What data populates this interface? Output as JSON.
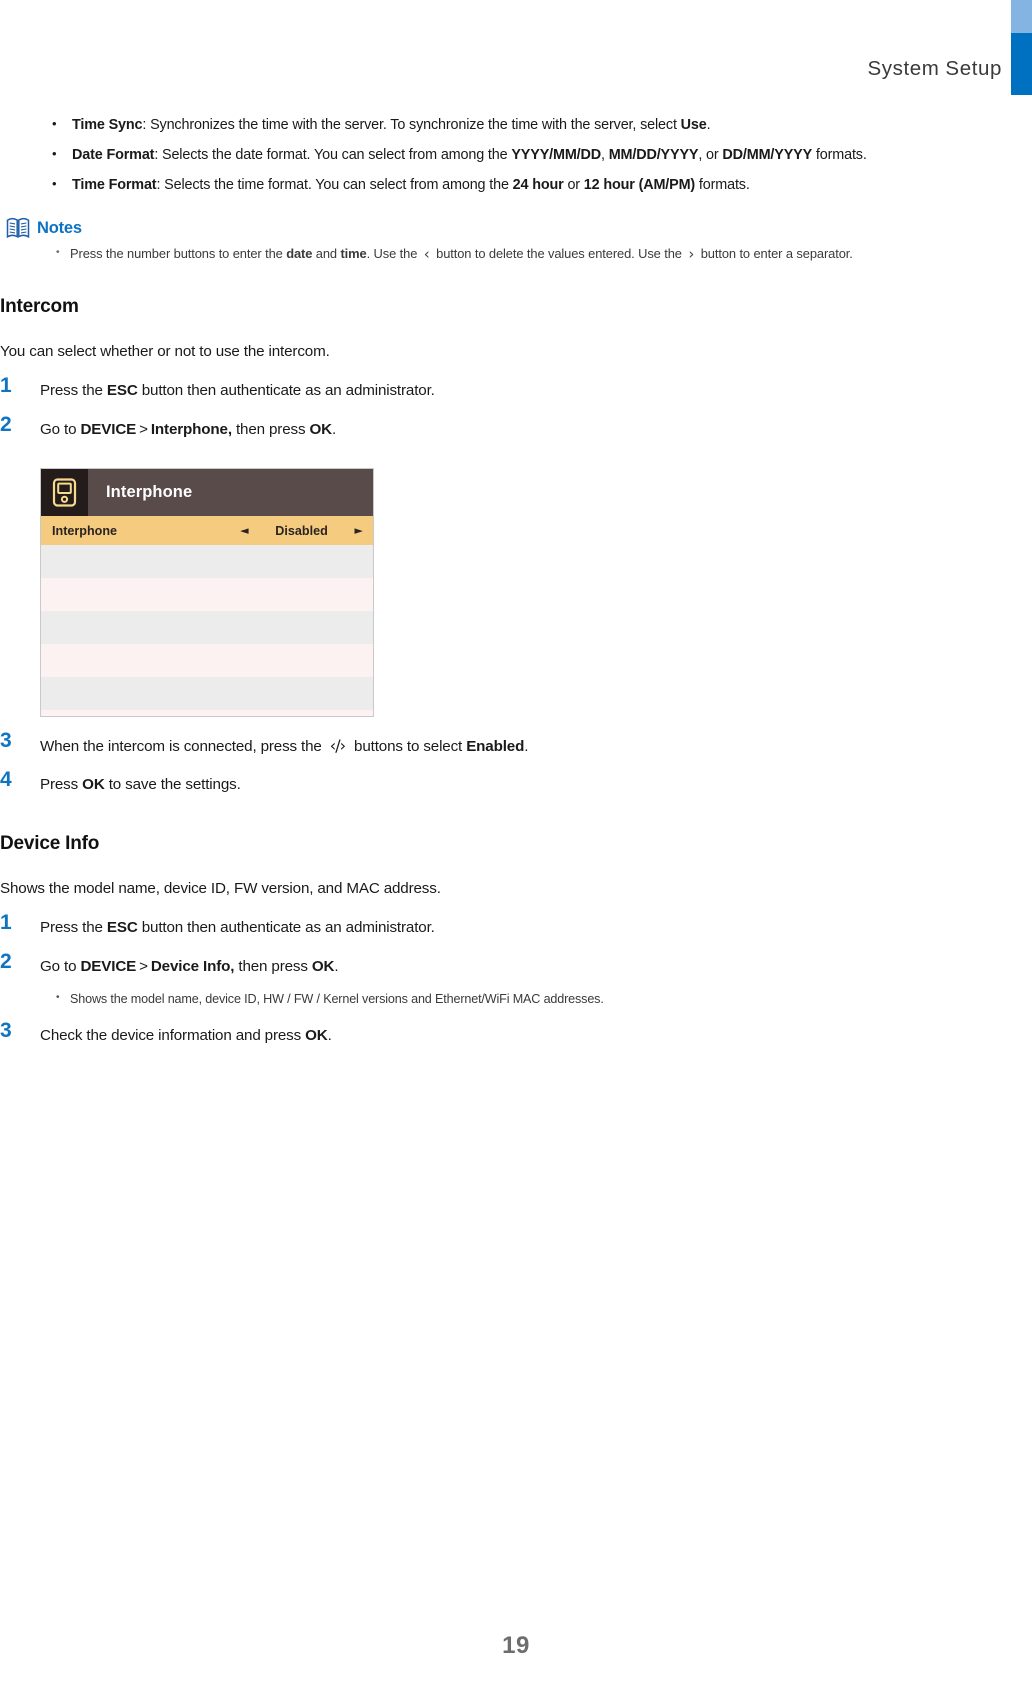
{
  "header": {
    "title_part1": "System",
    "title_part2": "Setup",
    "accent_light": "#84b4e2",
    "accent_dark": "#0070c0"
  },
  "top_bullets": [
    {
      "term": "Time Sync",
      "text_1": ": Synchronizes the time with the server. To synchronize the time with the server, select ",
      "bold_2": "Use",
      "text_3": "."
    },
    {
      "term": "Date Format",
      "text_1": ": Selects the date format. You can select from among the ",
      "bold_2": "YYYY/MM/DD",
      "text_3": ", ",
      "bold_4": "MM/DD/YYYY",
      "text_5": ", or ",
      "bold_6": "DD/MM/YYYY",
      "text_7": " formats."
    },
    {
      "term": "Time Format",
      "text_1": ": Selects the time format. You can select from among the ",
      "bold_2": "24 hour",
      "text_3": " or ",
      "bold_4": "12 hour (AM/PM)",
      "text_5": " formats."
    }
  ],
  "notes": {
    "label": "Notes",
    "icon": "open-book-icon",
    "accent": "#0b72c4",
    "line": {
      "text_1": "Press the number buttons to enter the ",
      "bold_2": "date",
      "text_3": " and ",
      "bold_4": "time",
      "text_5": ". Use the ",
      "glyph_left": "‹",
      "text_6": " button to delete the values entered. Use the ",
      "glyph_right": "›",
      "text_7": " button to enter a separator."
    }
  },
  "intercom": {
    "heading": "Intercom",
    "intro": "You can select whether or not to use the intercom.",
    "steps": [
      {
        "num": "1",
        "text_1": "Press the ",
        "bold_2": "ESC",
        "text_3": " button then authenticate as an administrator."
      },
      {
        "num": "2",
        "text_1": "Go to ",
        "bold_2": "DEVICE",
        "sep": ">",
        "bold_3": "Interphone,",
        "text_4": " then press ",
        "bold_5": "OK",
        "text_6": "."
      },
      {
        "num": "3",
        "text_1": "When the intercom is connected, press the ",
        "glyph": "‹/›",
        "text_2": " buttons to select ",
        "bold_3": "Enabled",
        "text_4": "."
      },
      {
        "num": "4",
        "text_1": "Press ",
        "bold_2": "OK",
        "text_3": " to save the settings."
      }
    ],
    "device_screen": {
      "icon": "device-terminal-icon",
      "title": "Interphone",
      "selected_row": {
        "label": "Interphone",
        "value": "Disabled",
        "caret_left": "◄",
        "caret_right": "►"
      },
      "blank_row_count": 6,
      "colors": {
        "titlebar": "#584b49",
        "iconbox": "#231c1a",
        "selected_row": "#f5cc7f",
        "row_gray": "#ececec",
        "row_pink": "#fdf2f2"
      }
    }
  },
  "device_info": {
    "heading": "Device Info",
    "intro": "Shows the model name, device ID, FW version, and MAC address.",
    "steps": [
      {
        "num": "1",
        "text_1": "Press the ",
        "bold_2": "ESC",
        "text_3": " button then authenticate as an administrator."
      },
      {
        "num": "2",
        "text_1": "Go to ",
        "bold_2": "DEVICE",
        "sep": ">",
        "bold_3": "Device Info,",
        "text_4": " then press ",
        "bold_5": "OK",
        "text_6": "."
      },
      {
        "num": "3",
        "text_1": "Check the device information and press ",
        "bold_2": "OK",
        "text_3": "."
      }
    ],
    "sub_bullet": "Shows the model name, device ID, HW / FW / Kernel versions and Ethernet/WiFi MAC addresses."
  },
  "footer": {
    "page_number": "19"
  }
}
